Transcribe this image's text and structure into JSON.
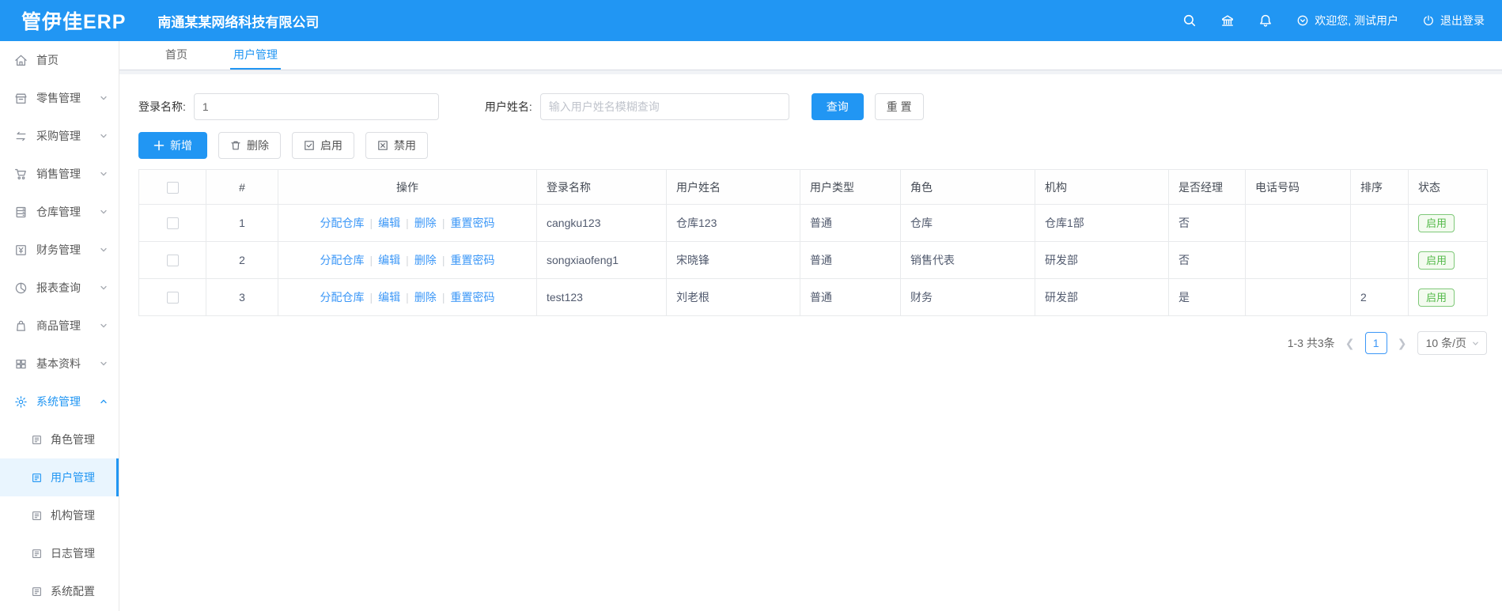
{
  "header": {
    "logo": "管伊佳ERP",
    "company": "南通某某网络科技有限公司",
    "welcome": "欢迎您, 测试用户",
    "logout": "退出登录"
  },
  "sidebar": {
    "items": [
      {
        "label": "首页",
        "icon": "home-icon"
      },
      {
        "label": "零售管理",
        "icon": "retail-icon"
      },
      {
        "label": "采购管理",
        "icon": "purchase-icon"
      },
      {
        "label": "销售管理",
        "icon": "sales-cart-icon"
      },
      {
        "label": "仓库管理",
        "icon": "warehouse-icon"
      },
      {
        "label": "财务管理",
        "icon": "finance-icon"
      },
      {
        "label": "报表查询",
        "icon": "report-pie-icon"
      },
      {
        "label": "商品管理",
        "icon": "goods-bag-icon"
      },
      {
        "label": "基本资料",
        "icon": "basic-data-icon"
      },
      {
        "label": "系统管理",
        "icon": "gear-icon",
        "active": true,
        "expanded": true
      }
    ],
    "system_children": [
      {
        "label": "角色管理"
      },
      {
        "label": "用户管理",
        "active": true
      },
      {
        "label": "机构管理"
      },
      {
        "label": "日志管理"
      },
      {
        "label": "系统配置"
      }
    ]
  },
  "tabs": [
    {
      "label": "首页"
    },
    {
      "label": "用户管理",
      "active": true
    }
  ],
  "filters": {
    "login_label": "登录名称:",
    "login_value": "1",
    "name_label": "用户姓名:",
    "name_placeholder": "输入用户姓名模糊查询",
    "search_button": "查询",
    "reset_button": "重 置"
  },
  "toolbar": {
    "add": "新增",
    "delete": "删除",
    "enable": "启用",
    "disable": "禁用"
  },
  "table": {
    "columns": {
      "index": "#",
      "ops": "操作",
      "login": "登录名称",
      "name": "用户姓名",
      "type": "用户类型",
      "role": "角色",
      "org": "机构",
      "manager": "是否经理",
      "phone": "电话号码",
      "sort": "排序",
      "status": "状态"
    },
    "op_labels": [
      "分配仓库",
      "编辑",
      "删除",
      "重置密码"
    ],
    "rows": [
      {
        "index": "1",
        "login": "cangku123",
        "name": "仓库123",
        "type": "普通",
        "role": "仓库",
        "org": "仓库1部",
        "manager": "否",
        "phone": "",
        "sort": "",
        "status": "启用"
      },
      {
        "index": "2",
        "login": "songxiaofeng1",
        "name": "宋晓锋",
        "type": "普通",
        "role": "销售代表",
        "org": "研发部",
        "manager": "否",
        "phone": "",
        "sort": "",
        "status": "启用"
      },
      {
        "index": "3",
        "login": "test123",
        "name": "刘老根",
        "type": "普通",
        "role": "财务",
        "org": "研发部",
        "manager": "是",
        "phone": "",
        "sort": "2",
        "status": "启用"
      }
    ]
  },
  "pagination": {
    "total_text": "1-3 共3条",
    "current_page": "1",
    "page_size": "10 条/页"
  },
  "colors": {
    "primary": "#2196F3",
    "link": "#3B97F7",
    "success": "#52b948"
  }
}
